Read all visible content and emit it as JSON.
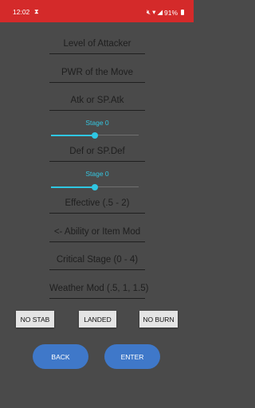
{
  "status_bar": {
    "time": "12:02",
    "icons": [
      "hourglass-icon",
      "mute-icon",
      "wifi-icon",
      "signal-icon",
      "battery-icon"
    ],
    "battery": "91%",
    "color": "#d42a2a"
  },
  "form": {
    "level_placeholder": "Level of Attacker",
    "power_placeholder": "PWR of the Move",
    "atk_placeholder": "Atk or SP.Atk",
    "atk_stage_label": "Stage 0",
    "atk_stage_value": 0,
    "def_placeholder": "Def or SP.Def",
    "def_stage_label": "Stage 0",
    "def_stage_value": 0,
    "effective_placeholder": "Effective (.5 - 2)",
    "modifier_placeholder": "<- Ability or Item Mod",
    "critical_placeholder": "Critical Stage (0 - 4)",
    "weather_placeholder": "Weather Mod (.5, 1, 1.5)"
  },
  "toggles": {
    "stab": "NO STAB",
    "landed": "LANDED",
    "burn": "NO BURN"
  },
  "actions": {
    "back": "BACK",
    "enter": "ENTER",
    "accent": "#3f78c9"
  }
}
